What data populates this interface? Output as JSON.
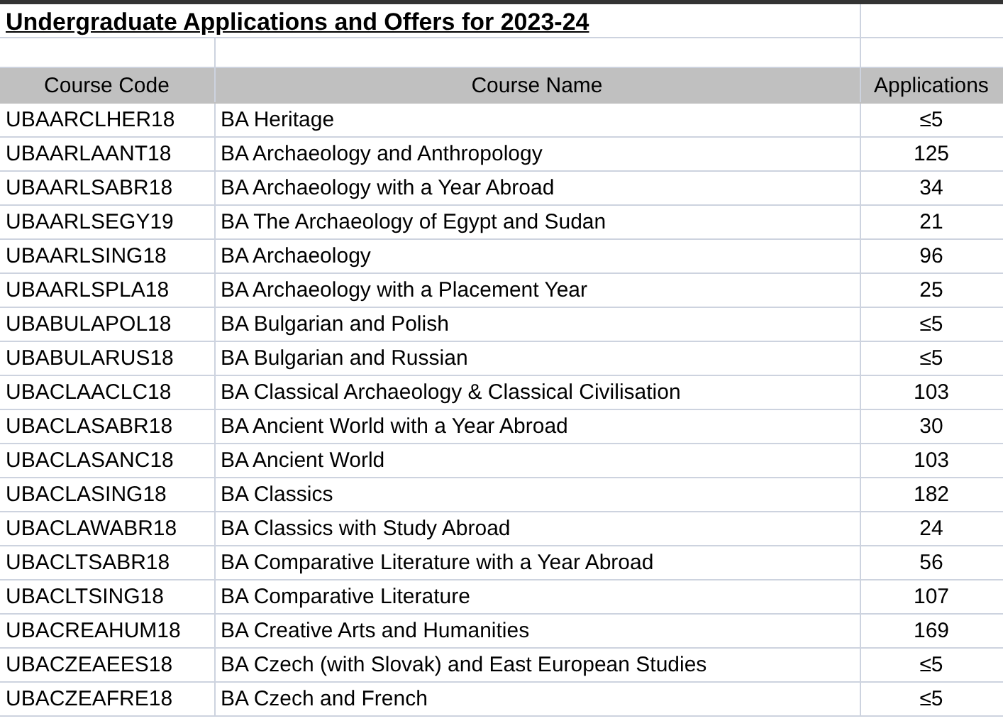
{
  "title": "Undergraduate Applications and Offers for 2023-24",
  "table": {
    "columns": [
      "Course Code",
      "Course Name",
      "Applications"
    ],
    "rows": [
      [
        "UBAARCLHER18",
        "BA Heritage",
        "≤5"
      ],
      [
        "UBAARLAANT18",
        "BA Archaeology and Anthropology",
        "125"
      ],
      [
        "UBAARLSABR18",
        "BA Archaeology with a Year Abroad",
        "34"
      ],
      [
        "UBAARLSEGY19",
        "BA The Archaeology of Egypt and Sudan",
        "21"
      ],
      [
        "UBAARLSING18",
        "BA Archaeology",
        "96"
      ],
      [
        "UBAARLSPLA18",
        "BA Archaeology with a Placement Year",
        "25"
      ],
      [
        "UBABULAPOL18",
        "BA Bulgarian and Polish",
        "≤5"
      ],
      [
        "UBABULARUS18",
        "BA Bulgarian and Russian",
        "≤5"
      ],
      [
        "UBACLAACLC18",
        "BA Classical Archaeology & Classical Civilisation",
        "103"
      ],
      [
        "UBACLASABR18",
        "BA Ancient World with a Year Abroad",
        "30"
      ],
      [
        "UBACLASANC18",
        "BA Ancient World",
        "103"
      ],
      [
        "UBACLASING18",
        "BA Classics",
        "182"
      ],
      [
        "UBACLAWABR18",
        "BA Classics with Study Abroad",
        "24"
      ],
      [
        "UBACLTSABR18",
        "BA Comparative Literature with a Year Abroad",
        "56"
      ],
      [
        "UBACLTSING18",
        "BA Comparative Literature",
        "107"
      ],
      [
        "UBACREAHUM18",
        "BA Creative Arts and Humanities",
        "169"
      ],
      [
        "UBACZEAEES18",
        "BA Czech (with Slovak) and East European Studies",
        "≤5"
      ],
      [
        "UBACZEAFRE18",
        "BA Czech and French",
        "≤5"
      ]
    ]
  }
}
